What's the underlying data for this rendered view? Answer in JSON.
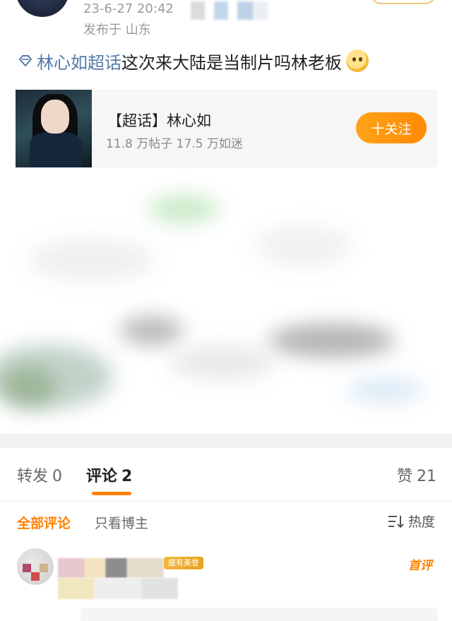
{
  "header": {
    "time": "23-6-27 20:42",
    "location": "发布于 山东"
  },
  "post": {
    "topic": "林心如超话",
    "text": "这次来大陆是当制片吗林老板",
    "emoji": "laughing-face"
  },
  "topic_card": {
    "title": "【超话】林心如",
    "stats": "11.8 万帖子  17.5 万如迷",
    "follow_label": "十关注"
  },
  "tabs": [
    {
      "label": "转发",
      "count": "0"
    },
    {
      "label": "评论",
      "count": "2",
      "active": true
    },
    {
      "label": "赞",
      "count": "21"
    }
  ],
  "filters": {
    "all": "全部评论",
    "owner_only": "只看博主",
    "sort": "热度"
  },
  "comment": {
    "badge": "盛有美誉",
    "first_label": "首评"
  },
  "colors": {
    "accent": "#ff8200",
    "link": "#5479a8",
    "follow_button": "#ff9a12"
  }
}
